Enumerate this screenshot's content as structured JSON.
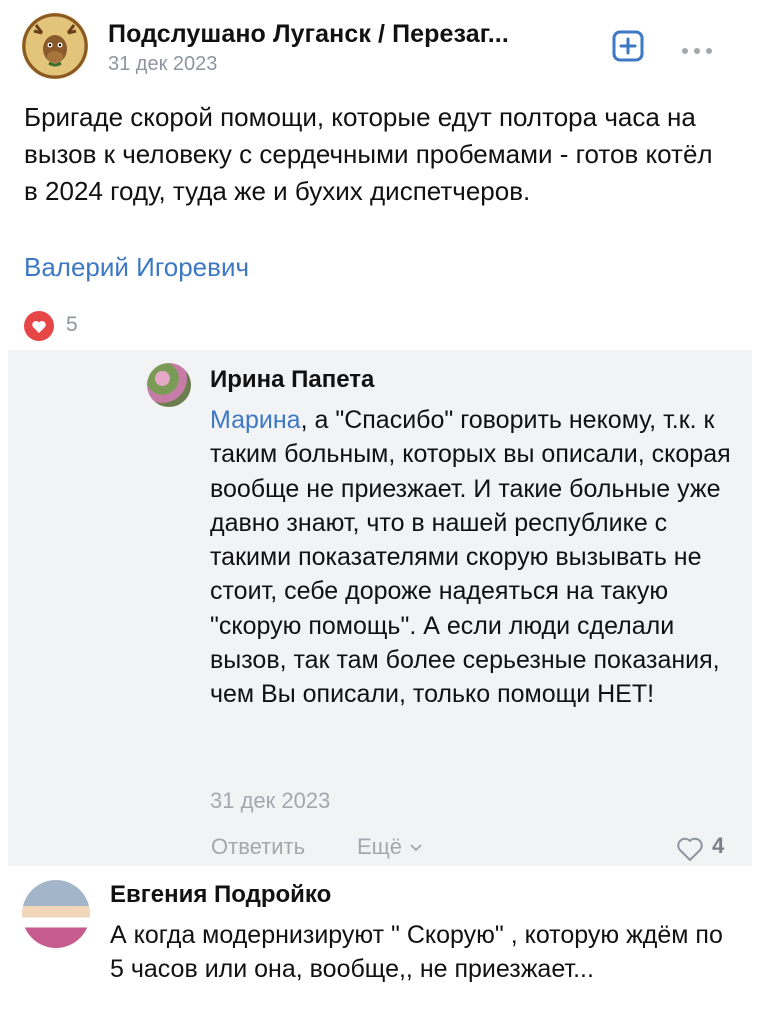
{
  "post": {
    "group_name": "Подслушано Луганск / Перезаг...",
    "date": "31 дек 2023",
    "text": "Бригаде скорой помощи, которые едут полтора часа на вызов к человеку с сердечными пробемами - готов котёл в 2024 году, туда же и бухих диспетчеров.",
    "author": "Валерий Игоревич",
    "likes": "5",
    "add_icon": "plus-square-icon",
    "more_icon": "more-dots-icon"
  },
  "reply": {
    "author": "Ирина Папета",
    "mention": "Марина",
    "text": ", а \"Спасибо\" говорить некому, т.к. к таким больным, которых вы описали, скорая вообще не приезжает. И такие больные уже давно знают, что в нашей республике с такими показателями скорую вызывать не стоит, себе дороже надеяться на такую \"скорую помощь\". А если люди сделали вызов, так там более серьезные показания, чем Вы описали, только помощи НЕТ!",
    "date": "31 дек 2023",
    "reply_label": "Ответить",
    "more_label": "Ещё",
    "likes": "4"
  },
  "comment2": {
    "author": "Евгения Подройко",
    "text": "А когда модернизируют \" Скорую\" , которую ждём по 5 часов или она, вообще,, не приезжает..."
  },
  "colors": {
    "link": "#3d78c4",
    "like_red": "#e64646",
    "muted": "#8f959e",
    "reply_bg": "#f2f3f5"
  }
}
